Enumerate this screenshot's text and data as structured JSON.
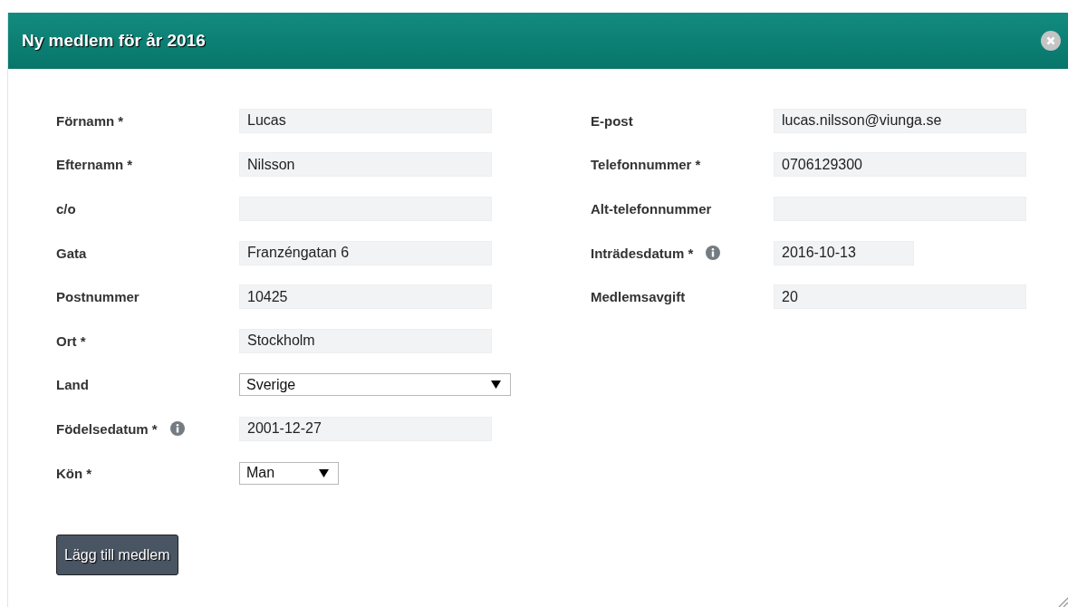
{
  "dialog": {
    "title": "Ny medlem för år 2016"
  },
  "left_fields": [
    {
      "label": "Förnamn *",
      "value": "Lucas",
      "kind": "input",
      "info": false
    },
    {
      "label": "Efternamn *",
      "value": "Nilsson",
      "kind": "input",
      "info": false
    },
    {
      "label": "c/o",
      "kind": "input",
      "info": false
    },
    {
      "label": "Gata",
      "value": "Franzéngatan 6",
      "kind": "input",
      "info": false
    },
    {
      "label": "Postnummer",
      "value": "10425",
      "kind": "input",
      "info": false
    },
    {
      "label": "Ort *",
      "value": "Stockholm",
      "kind": "input",
      "info": false
    },
    {
      "label": "Land",
      "value": "Sverige",
      "kind": "select",
      "info": false
    },
    {
      "label": "Födelsedatum *",
      "value": "2001-12-27",
      "kind": "input",
      "info": true
    },
    {
      "label": "Kön *",
      "value": "Man",
      "kind": "short-select",
      "info": false
    }
  ],
  "right_fields": [
    {
      "label": "E-post",
      "value": "lucas.nilsson@viunga.se",
      "kind": "input",
      "info": false
    },
    {
      "label": "Telefonnummer *",
      "value": "0706129300",
      "kind": "input",
      "info": false
    },
    {
      "label": "Alt-telefonnummer",
      "kind": "input",
      "info": false
    },
    {
      "label": "Inträdesdatum *",
      "value": "2016-10-13",
      "kind": "short-input",
      "info": true
    },
    {
      "label": "Medlemsavgift",
      "value": "20",
      "kind": "input",
      "info": false
    }
  ],
  "submit_button": "Lägg till medlem"
}
